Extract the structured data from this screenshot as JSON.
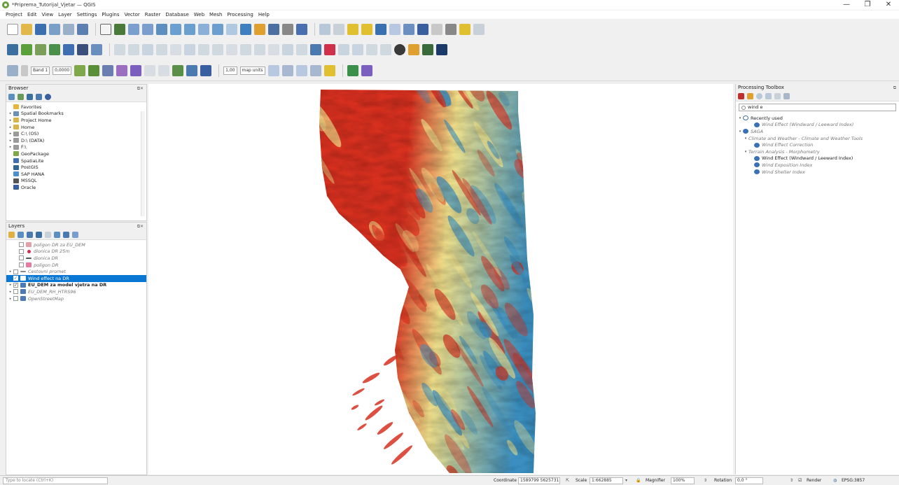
{
  "window": {
    "title": "*Priprema_Tutorijal_Vjetar — QGIS",
    "minimize": "—",
    "maximize": "❐",
    "close": "✕"
  },
  "menu": [
    "Project",
    "Edit",
    "View",
    "Layer",
    "Settings",
    "Plugins",
    "Vector",
    "Raster",
    "Database",
    "Web",
    "Mesh",
    "Processing",
    "Help"
  ],
  "raster_toolbar": {
    "band_label": "Band 1",
    "value_field": "0,0000",
    "line_width": "1,00",
    "units": "map units"
  },
  "browser": {
    "title": "Browser",
    "items": [
      {
        "label": "Favorites",
        "icon": "star-icon",
        "color": "#e8b63a",
        "arrow": ""
      },
      {
        "label": "Spatial Bookmarks",
        "icon": "bookmark-icon",
        "color": "#6b8fb5",
        "arrow": "▸"
      },
      {
        "label": "Project Home",
        "icon": "folder-icon",
        "color": "#d8b34a",
        "arrow": "▸"
      },
      {
        "label": "Home",
        "icon": "folder-icon",
        "color": "#d8b34a",
        "arrow": "▸"
      },
      {
        "label": "C:\\ (OS)",
        "icon": "drive-icon",
        "color": "#9a9a9a",
        "arrow": "▸"
      },
      {
        "label": "D:\\ (DATA)",
        "icon": "drive-icon",
        "color": "#9a9a9a",
        "arrow": "▸"
      },
      {
        "label": "F:\\",
        "icon": "drive-icon",
        "color": "#9a9a9a",
        "arrow": "▸"
      },
      {
        "label": "GeoPackage",
        "icon": "geopackage-icon",
        "color": "#7fa84a",
        "arrow": ""
      },
      {
        "label": "SpatiaLite",
        "icon": "spatialite-icon",
        "color": "#3f6fb0",
        "arrow": ""
      },
      {
        "label": "PostGIS",
        "icon": "postgis-icon",
        "color": "#336791",
        "arrow": ""
      },
      {
        "label": "SAP HANA",
        "icon": "database-icon",
        "color": "#4a8fcf",
        "arrow": ""
      },
      {
        "label": "MSSQL",
        "icon": "database-icon",
        "color": "#555555",
        "arrow": ""
      },
      {
        "label": "Oracle",
        "icon": "database-icon",
        "color": "#3a5fa0",
        "arrow": ""
      }
    ]
  },
  "layers": {
    "title": "Layers",
    "items": [
      {
        "label": "poligon DR za EU_DEM",
        "icon": "polygon-icon",
        "color": "#e4a0a8",
        "style": "grey",
        "checked": "",
        "arrow": "",
        "indent": 1
      },
      {
        "label": "dionica DR 25m",
        "icon": "point-icon",
        "color": "#d03050",
        "style": "grey",
        "checked": "",
        "arrow": "",
        "indent": 1
      },
      {
        "label": "dionica DR",
        "icon": "line-icon",
        "color": "#555555",
        "style": "grey",
        "checked": "",
        "arrow": "",
        "indent": 1
      },
      {
        "label": "poligon DR",
        "icon": "polygon-icon",
        "color": "#e87aa0",
        "style": "grey",
        "checked": "",
        "arrow": "",
        "indent": 1
      },
      {
        "label": "Cestovni promet",
        "icon": "line-icon",
        "color": "#888888",
        "style": "grey",
        "checked": "",
        "arrow": "▸",
        "indent": 0
      },
      {
        "label": "Wind effect na DR",
        "icon": "raster-icon",
        "color": "#ffffff",
        "style": "sel",
        "checked": "✓",
        "arrow": "",
        "indent": 0
      },
      {
        "label": "EU_DEM za model vjetra na DR",
        "icon": "raster-icon",
        "color": "#4a7ab8",
        "style": "bold",
        "checked": "✓",
        "arrow": "▸",
        "indent": 0
      },
      {
        "label": "EU_DEM_RH_HTRS96",
        "icon": "raster-icon",
        "color": "#4a7ab8",
        "style": "grey",
        "checked": "",
        "arrow": "▸",
        "indent": 0
      },
      {
        "label": "OpenStreetMap",
        "icon": "raster-icon",
        "color": "#4a7ab8",
        "style": "grey",
        "checked": "",
        "arrow": "▸",
        "indent": 0
      }
    ]
  },
  "toolbox": {
    "title": "Processing Toolbox",
    "search_value": "wind e",
    "items": [
      {
        "label": "Recently used",
        "icon": "clock-icon",
        "style": "normal",
        "arrow": "▾",
        "indent": 0
      },
      {
        "label": "Wind Effect (Windward / Leeward Index)",
        "icon": "saga-icon",
        "style": "grey",
        "arrow": "",
        "indent": 2
      },
      {
        "label": "SAGA",
        "icon": "saga-icon",
        "style": "grey",
        "arrow": "▾",
        "indent": 0
      },
      {
        "label": "Climate and Weather - Climate and Weather Tools",
        "icon": "",
        "style": "grey",
        "arrow": "▾",
        "indent": 1
      },
      {
        "label": "Wind Effect Correction",
        "icon": "saga-icon",
        "style": "grey",
        "arrow": "",
        "indent": 2
      },
      {
        "label": "Terrain Analysis - Morphometry",
        "icon": "",
        "style": "grey",
        "arrow": "▾",
        "indent": 1
      },
      {
        "label": "Wind Effect (Windward / Leeward Index)",
        "icon": "saga-icon",
        "style": "normal",
        "arrow": "",
        "indent": 2
      },
      {
        "label": "Wind Exposition Index",
        "icon": "saga-icon",
        "style": "grey",
        "arrow": "",
        "indent": 2
      },
      {
        "label": "Wind Shelter Index",
        "icon": "saga-icon",
        "style": "grey",
        "arrow": "",
        "indent": 2
      }
    ]
  },
  "status": {
    "locator_placeholder": "Type to locate (Ctrl+K)",
    "coordinate_label": "Coordinate",
    "coordinate_value": "1589799 5625731",
    "scale_label": "Scale",
    "scale_value": "1:662885",
    "magnifier_label": "Magnifier",
    "magnifier_value": "100%",
    "rotation_label": "Rotation",
    "rotation_value": "0,0 °",
    "render_label": "Render",
    "crs_label": "EPSG:3857"
  },
  "colors": {
    "selection": "#0b77d4",
    "ramp_high": "#d7301f",
    "ramp_mid": "#f0e08a",
    "ramp_low": "#3a8fc0"
  }
}
